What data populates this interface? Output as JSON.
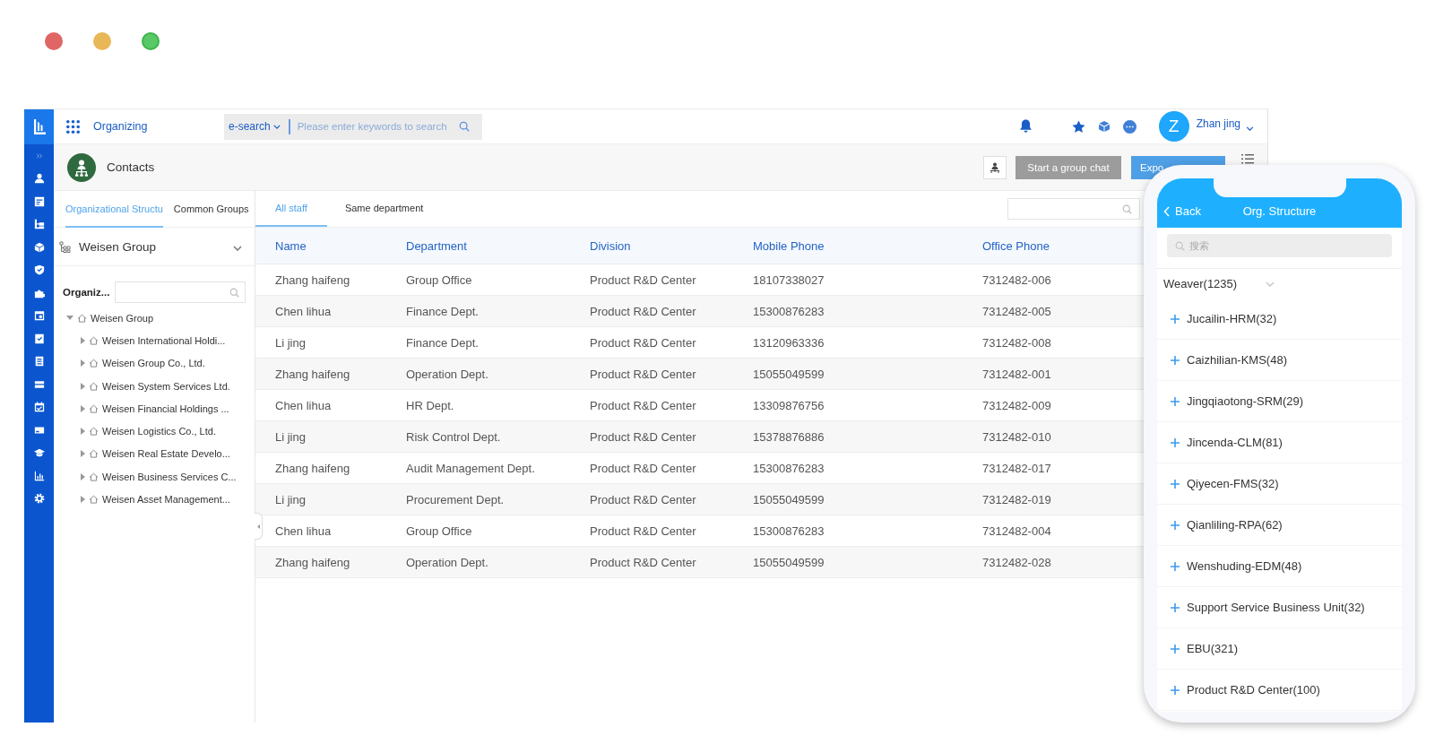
{
  "header": {
    "app_title": "Organizing",
    "search_scope": "e-search",
    "search": {
      "placeholder": "Please enter keywords to search"
    },
    "user": {
      "initial": "Z",
      "name": "Zhan jing"
    }
  },
  "page": {
    "title": "Contacts",
    "buttons": [
      {
        "label": "Start a group chat",
        "disabled": true
      },
      {
        "label": "Expo",
        "disabled": false
      }
    ]
  },
  "left_panel": {
    "tabs": [
      {
        "label": "Organizational Structu",
        "selected": true
      },
      {
        "label": "Common Groups",
        "selected": false
      }
    ],
    "org_selector": "Weisen Group",
    "search_label": "Organiz...",
    "tree": [
      {
        "label": "Weisen Group",
        "expanded": true,
        "children": [
          {
            "label": "Weisen International Holdi...",
            "expanded": false
          },
          {
            "label": "Weisen Group Co., Ltd.",
            "expanded": false
          },
          {
            "label": "Weisen System Services Ltd.",
            "expanded": false
          },
          {
            "label": "Weisen Financial Holdings ...",
            "expanded": false
          },
          {
            "label": "Weisen Logistics Co., Ltd.",
            "expanded": false
          },
          {
            "label": "Weisen Real Estate Develo...",
            "expanded": false
          },
          {
            "label": "Weisen Business Services C...",
            "expanded": false
          },
          {
            "label": "Weisen Asset Management...",
            "expanded": false
          }
        ]
      }
    ]
  },
  "main": {
    "tabs": [
      {
        "label": "All staff",
        "selected": true
      },
      {
        "label": "Same department",
        "selected": false
      }
    ],
    "table": {
      "columns": [
        "Name",
        "Department",
        "Division",
        "Mobile Phone",
        "Office Phone"
      ],
      "rows": [
        [
          "Zhang haifeng",
          "Group Office",
          "Product R&D Center",
          "18107338027",
          "7312482-006"
        ],
        [
          "Chen lihua",
          "Finance Dept.",
          "Product R&D Center",
          "15300876283",
          "7312482-005"
        ],
        [
          "Li jing",
          "Finance Dept.",
          "Product R&D Center",
          "13120963336",
          "7312482-008"
        ],
        [
          "Zhang haifeng",
          "Operation Dept.",
          "Product R&D Center",
          "15055049599",
          "7312482-001"
        ],
        [
          "Chen lihua",
          "HR Dept.",
          "Product R&D Center",
          "13309876756",
          "7312482-009"
        ],
        [
          "Li jing",
          "Risk Control Dept.",
          "Product R&D Center",
          "15378876886",
          "7312482-010"
        ],
        [
          "Zhang haifeng",
          "Audit Management Dept.",
          "Product R&D Center",
          "15300876283",
          "7312482-017"
        ],
        [
          "Li jing",
          "Procurement Dept.",
          "Product R&D Center",
          "15055049599",
          "7312482-019"
        ],
        [
          "Chen lihua",
          "Group Office",
          "Product R&D Center",
          "15300876283",
          "7312482-004"
        ],
        [
          "Zhang haifeng",
          "Operation Dept.",
          "Product R&D Center",
          "15055049599",
          "7312482-028"
        ]
      ]
    }
  },
  "phone": {
    "back": "Back",
    "title": "Org. Structure",
    "search": {
      "placeholder": "搜索"
    },
    "root": "Weaver(1235)",
    "items": [
      "Jucailin-HRM(32)",
      "Caizhilian-KMS(48)",
      "Jingqiaotong-SRM(29)",
      "Jincenda-CLM(81)",
      "Qiyecen-FMS(32)",
      "Qianliling-RPA(62)",
      "Wenshuding-EDM(48)",
      "Support Service Business Unit(32)",
      "EBU(321)",
      "Product R&D Center(100)"
    ]
  }
}
